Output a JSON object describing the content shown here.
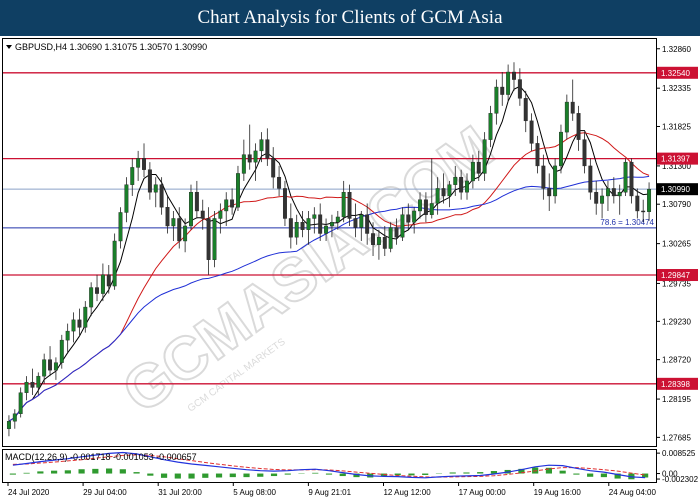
{
  "banner": {
    "title": "Chart Analysis for Clients of GCM Asia"
  },
  "header": {
    "symbol_line": "GBPUSD,H4  1.30690 1.31075 1.30570 1.30990",
    "macd_line": "MACD(12,26,9) -0.001718 -0.001053 -0.000657"
  },
  "watermark": {
    "text": "GCMASIA.COM",
    "subtext": "GCM CAPITAL MARKETS"
  },
  "colors": {
    "bull": "#1a7f2a",
    "bear": "#333333",
    "ma_fast": "#000000",
    "ma_mid": "#d01818",
    "ma_slow": "#1f2fd6",
    "resistance": "#cc1133",
    "fib": "#2233aa",
    "last_price_line": "#8aa0c8",
    "macd_signal": "#e03030",
    "macd_main": "#2233dd",
    "histogram": "#2f9a2f"
  },
  "chart_data": [
    {
      "type": "candlestick",
      "title": "GBPUSD,H4",
      "ylim": [
        1.2765,
        1.3295
      ],
      "y_ticks": [
        "1.32860",
        "1.32335",
        "1.31825",
        "1.31300",
        "1.30790",
        "1.30265",
        "1.29735",
        "1.29230",
        "1.28720",
        "1.28195",
        "1.27685"
      ],
      "x_ticks": [
        "24 Jul 2020",
        "29 Jul 04:00",
        "31 Jul 20:00",
        "5 Aug 08:00",
        "9 Aug 21:01",
        "12 Aug 12:00",
        "17 Aug 00:00",
        "19 Aug 16:00",
        "24 Aug 04:00"
      ],
      "grid": false,
      "candles": [
        {
          "o": 1.278,
          "h": 1.2798,
          "l": 1.277,
          "c": 1.279
        },
        {
          "o": 1.279,
          "h": 1.2806,
          "l": 1.278,
          "c": 1.28
        },
        {
          "o": 1.28,
          "h": 1.2835,
          "l": 1.2795,
          "c": 1.2828
        },
        {
          "o": 1.2828,
          "h": 1.285,
          "l": 1.2818,
          "c": 1.2842
        },
        {
          "o": 1.2842,
          "h": 1.286,
          "l": 1.2825,
          "c": 1.2835
        },
        {
          "o": 1.2835,
          "h": 1.2855,
          "l": 1.2825,
          "c": 1.285
        },
        {
          "o": 1.285,
          "h": 1.288,
          "l": 1.284,
          "c": 1.2872
        },
        {
          "o": 1.2872,
          "h": 1.289,
          "l": 1.285,
          "c": 1.2858
        },
        {
          "o": 1.2858,
          "h": 1.2875,
          "l": 1.2845,
          "c": 1.2868
        },
        {
          "o": 1.2868,
          "h": 1.2905,
          "l": 1.286,
          "c": 1.2898
        },
        {
          "o": 1.2898,
          "h": 1.292,
          "l": 1.288,
          "c": 1.291
        },
        {
          "o": 1.291,
          "h": 1.2935,
          "l": 1.2895,
          "c": 1.2925
        },
        {
          "o": 1.2925,
          "h": 1.294,
          "l": 1.2905,
          "c": 1.2915
        },
        {
          "o": 1.2915,
          "h": 1.295,
          "l": 1.2908,
          "c": 1.2942
        },
        {
          "o": 1.2942,
          "h": 1.2975,
          "l": 1.293,
          "c": 1.2968
        },
        {
          "o": 1.2968,
          "h": 1.2985,
          "l": 1.295,
          "c": 1.296
        },
        {
          "o": 1.296,
          "h": 1.3,
          "l": 1.295,
          "c": 1.2985
        },
        {
          "o": 1.2985,
          "h": 1.2998,
          "l": 1.296,
          "c": 1.297
        },
        {
          "o": 1.297,
          "h": 1.304,
          "l": 1.2965,
          "c": 1.303
        },
        {
          "o": 1.303,
          "h": 1.3075,
          "l": 1.302,
          "c": 1.3068
        },
        {
          "o": 1.3068,
          "h": 1.3115,
          "l": 1.3055,
          "c": 1.3105
        },
        {
          "o": 1.3105,
          "h": 1.314,
          "l": 1.309,
          "c": 1.3128
        },
        {
          "o": 1.3128,
          "h": 1.315,
          "l": 1.311,
          "c": 1.314
        },
        {
          "o": 1.314,
          "h": 1.316,
          "l": 1.3115,
          "c": 1.3125
        },
        {
          "o": 1.3125,
          "h": 1.3135,
          "l": 1.3085,
          "c": 1.3095
        },
        {
          "o": 1.3095,
          "h": 1.3115,
          "l": 1.3075,
          "c": 1.3105
        },
        {
          "o": 1.3105,
          "h": 1.3115,
          "l": 1.3065,
          "c": 1.3075
        },
        {
          "o": 1.3075,
          "h": 1.309,
          "l": 1.304,
          "c": 1.305
        },
        {
          "o": 1.305,
          "h": 1.307,
          "l": 1.303,
          "c": 1.306
        },
        {
          "o": 1.306,
          "h": 1.3075,
          "l": 1.302,
          "c": 1.303
        },
        {
          "o": 1.303,
          "h": 1.306,
          "l": 1.3015,
          "c": 1.305
        },
        {
          "o": 1.305,
          "h": 1.3105,
          "l": 1.3045,
          "c": 1.3095
        },
        {
          "o": 1.3095,
          "h": 1.311,
          "l": 1.306,
          "c": 1.307
        },
        {
          "o": 1.307,
          "h": 1.3085,
          "l": 1.3045,
          "c": 1.306
        },
        {
          "o": 1.306,
          "h": 1.3075,
          "l": 1.2985,
          "c": 1.3005
        },
        {
          "o": 1.3005,
          "h": 1.307,
          "l": 1.2995,
          "c": 1.306
        },
        {
          "o": 1.306,
          "h": 1.308,
          "l": 1.304,
          "c": 1.307
        },
        {
          "o": 1.307,
          "h": 1.3095,
          "l": 1.305,
          "c": 1.3085
        },
        {
          "o": 1.3085,
          "h": 1.31,
          "l": 1.3065,
          "c": 1.3075
        },
        {
          "o": 1.3075,
          "h": 1.313,
          "l": 1.307,
          "c": 1.312
        },
        {
          "o": 1.312,
          "h": 1.3165,
          "l": 1.311,
          "c": 1.3145
        },
        {
          "o": 1.3145,
          "h": 1.3185,
          "l": 1.3125,
          "c": 1.3135
        },
        {
          "o": 1.3135,
          "h": 1.316,
          "l": 1.311,
          "c": 1.315
        },
        {
          "o": 1.315,
          "h": 1.3175,
          "l": 1.3135,
          "c": 1.3165
        },
        {
          "o": 1.3165,
          "h": 1.318,
          "l": 1.313,
          "c": 1.314
        },
        {
          "o": 1.314,
          "h": 1.3155,
          "l": 1.31,
          "c": 1.3115
        },
        {
          "o": 1.3115,
          "h": 1.313,
          "l": 1.309,
          "c": 1.31
        },
        {
          "o": 1.31,
          "h": 1.311,
          "l": 1.305,
          "c": 1.306
        },
        {
          "o": 1.306,
          "h": 1.308,
          "l": 1.302,
          "c": 1.3035
        },
        {
          "o": 1.3035,
          "h": 1.3065,
          "l": 1.3025,
          "c": 1.3055
        },
        {
          "o": 1.3055,
          "h": 1.307,
          "l": 1.3035,
          "c": 1.3045
        },
        {
          "o": 1.3045,
          "h": 1.307,
          "l": 1.3025,
          "c": 1.306
        },
        {
          "o": 1.306,
          "h": 1.3075,
          "l": 1.304,
          "c": 1.3065
        },
        {
          "o": 1.3065,
          "h": 1.308,
          "l": 1.303,
          "c": 1.304
        },
        {
          "o": 1.304,
          "h": 1.306,
          "l": 1.303,
          "c": 1.305
        },
        {
          "o": 1.305,
          "h": 1.3065,
          "l": 1.3035,
          "c": 1.3055
        },
        {
          "o": 1.3055,
          "h": 1.307,
          "l": 1.3045,
          "c": 1.3062
        },
        {
          "o": 1.3062,
          "h": 1.311,
          "l": 1.3055,
          "c": 1.3095
        },
        {
          "o": 1.3095,
          "h": 1.3105,
          "l": 1.305,
          "c": 1.306
        },
        {
          "o": 1.306,
          "h": 1.308,
          "l": 1.3035,
          "c": 1.3048
        },
        {
          "o": 1.3048,
          "h": 1.307,
          "l": 1.303,
          "c": 1.3065
        },
        {
          "o": 1.3065,
          "h": 1.308,
          "l": 1.3025,
          "c": 1.304
        },
        {
          "o": 1.304,
          "h": 1.3055,
          "l": 1.301,
          "c": 1.3025
        },
        {
          "o": 1.3025,
          "h": 1.3045,
          "l": 1.3005,
          "c": 1.3035
        },
        {
          "o": 1.3035,
          "h": 1.305,
          "l": 1.301,
          "c": 1.302
        },
        {
          "o": 1.302,
          "h": 1.3055,
          "l": 1.3015,
          "c": 1.3048
        },
        {
          "o": 1.3048,
          "h": 1.306,
          "l": 1.3025,
          "c": 1.3035
        },
        {
          "o": 1.3035,
          "h": 1.3075,
          "l": 1.303,
          "c": 1.3065
        },
        {
          "o": 1.3065,
          "h": 1.308,
          "l": 1.3045,
          "c": 1.3055
        },
        {
          "o": 1.3055,
          "h": 1.3075,
          "l": 1.304,
          "c": 1.307
        },
        {
          "o": 1.307,
          "h": 1.3095,
          "l": 1.306,
          "c": 1.3085
        },
        {
          "o": 1.3085,
          "h": 1.3095,
          "l": 1.3055,
          "c": 1.3065
        },
        {
          "o": 1.3065,
          "h": 1.314,
          "l": 1.306,
          "c": 1.308
        },
        {
          "o": 1.308,
          "h": 1.3115,
          "l": 1.3065,
          "c": 1.31
        },
        {
          "o": 1.31,
          "h": 1.312,
          "l": 1.308,
          "c": 1.309
        },
        {
          "o": 1.309,
          "h": 1.311,
          "l": 1.3075,
          "c": 1.3105
        },
        {
          "o": 1.3105,
          "h": 1.313,
          "l": 1.309,
          "c": 1.3115
        },
        {
          "o": 1.3115,
          "h": 1.3125,
          "l": 1.3085,
          "c": 1.3095
        },
        {
          "o": 1.3095,
          "h": 1.312,
          "l": 1.3085,
          "c": 1.311
        },
        {
          "o": 1.311,
          "h": 1.3145,
          "l": 1.31,
          "c": 1.3135
        },
        {
          "o": 1.3135,
          "h": 1.315,
          "l": 1.311,
          "c": 1.312
        },
        {
          "o": 1.312,
          "h": 1.3175,
          "l": 1.311,
          "c": 1.3165
        },
        {
          "o": 1.3165,
          "h": 1.321,
          "l": 1.3155,
          "c": 1.32
        },
        {
          "o": 1.32,
          "h": 1.3245,
          "l": 1.3185,
          "c": 1.3235
        },
        {
          "o": 1.3235,
          "h": 1.3255,
          "l": 1.321,
          "c": 1.3225
        },
        {
          "o": 1.3225,
          "h": 1.3265,
          "l": 1.3215,
          "c": 1.3255
        },
        {
          "o": 1.3255,
          "h": 1.3268,
          "l": 1.323,
          "c": 1.3245
        },
        {
          "o": 1.3245,
          "h": 1.326,
          "l": 1.321,
          "c": 1.322
        },
        {
          "o": 1.322,
          "h": 1.323,
          "l": 1.3175,
          "c": 1.319
        },
        {
          "o": 1.319,
          "h": 1.32,
          "l": 1.315,
          "c": 1.316
        },
        {
          "o": 1.316,
          "h": 1.317,
          "l": 1.312,
          "c": 1.313
        },
        {
          "o": 1.313,
          "h": 1.3145,
          "l": 1.3085,
          "c": 1.31
        },
        {
          "o": 1.31,
          "h": 1.312,
          "l": 1.307,
          "c": 1.309
        },
        {
          "o": 1.309,
          "h": 1.314,
          "l": 1.308,
          "c": 1.313
        },
        {
          "o": 1.313,
          "h": 1.3185,
          "l": 1.312,
          "c": 1.3175
        },
        {
          "o": 1.3175,
          "h": 1.3225,
          "l": 1.3165,
          "c": 1.3215
        },
        {
          "o": 1.3215,
          "h": 1.3245,
          "l": 1.319,
          "c": 1.32
        },
        {
          "o": 1.32,
          "h": 1.321,
          "l": 1.315,
          "c": 1.3165
        },
        {
          "o": 1.3165,
          "h": 1.3175,
          "l": 1.312,
          "c": 1.313
        },
        {
          "o": 1.313,
          "h": 1.314,
          "l": 1.3085,
          "c": 1.3095
        },
        {
          "o": 1.3095,
          "h": 1.311,
          "l": 1.3065,
          "c": 1.308
        },
        {
          "o": 1.308,
          "h": 1.31,
          "l": 1.306,
          "c": 1.309
        },
        {
          "o": 1.309,
          "h": 1.311,
          "l": 1.307,
          "c": 1.31
        },
        {
          "o": 1.31,
          "h": 1.3115,
          "l": 1.308,
          "c": 1.309
        },
        {
          "o": 1.309,
          "h": 1.3105,
          "l": 1.3065,
          "c": 1.3095
        },
        {
          "o": 1.3095,
          "h": 1.314,
          "l": 1.309,
          "c": 1.3135
        },
        {
          "o": 1.3135,
          "h": 1.314,
          "l": 1.308,
          "c": 1.309
        },
        {
          "o": 1.309,
          "h": 1.31,
          "l": 1.306,
          "c": 1.307
        },
        {
          "o": 1.307,
          "h": 1.3085,
          "l": 1.3055,
          "c": 1.3069
        },
        {
          "o": 1.3069,
          "h": 1.3108,
          "l": 1.3057,
          "c": 1.3099
        }
      ],
      "horizontal_lines": [
        {
          "kind": "resistance",
          "value": 1.3254,
          "label": "1.32540"
        },
        {
          "kind": "resistance",
          "value": 1.31397,
          "label": "1.31397"
        },
        {
          "kind": "current_price",
          "value": 1.3099,
          "label": "1.30990"
        },
        {
          "kind": "fibonacci",
          "value": 1.30474,
          "label": "78.6  = 1.30474"
        },
        {
          "kind": "support",
          "value": 1.29847,
          "label": "1.29847"
        },
        {
          "kind": "support",
          "value": 1.28398,
          "label": "1.28398"
        }
      ]
    },
    {
      "type": "line",
      "title": "MACD(12,26,9)",
      "ylim": [
        -0.0027,
        0.009
      ],
      "y_ticks": [
        "0.008525",
        "0.00",
        "-0.002302"
      ],
      "series": [
        {
          "name": "MACD",
          "style": "solid",
          "values": [
            0.0035,
            0.0042,
            0.005,
            0.0056,
            0.0062,
            0.007,
            0.0077,
            0.0084,
            0.0088,
            0.0082,
            0.007,
            0.0058,
            0.0048,
            0.004,
            0.0034,
            0.0028,
            0.0022,
            0.0016,
            0.0012,
            0.001,
            0.0012,
            0.0016,
            0.0018,
            0.0012,
            0.0004,
            -0.0004,
            -0.001,
            -0.0012,
            -0.0013,
            -0.0016,
            -0.0018,
            -0.0014,
            -0.0011,
            -0.001,
            -0.0008,
            -0.0002,
            0.0006,
            0.0016,
            0.0028,
            0.0035,
            0.0033,
            0.0022,
            0.0012,
            0.0006,
            -0.0004,
            -0.0014,
            -0.0017
          ]
        },
        {
          "name": "Signal",
          "style": "dashed",
          "values": [
            0.0038,
            0.004,
            0.0044,
            0.0048,
            0.0053,
            0.0058,
            0.0064,
            0.007,
            0.0076,
            0.0078,
            0.0076,
            0.007,
            0.0062,
            0.0054,
            0.0046,
            0.0039,
            0.0032,
            0.0026,
            0.0021,
            0.0017,
            0.0015,
            0.0015,
            0.0016,
            0.0015,
            0.0011,
            0.0006,
            0.0001,
            -0.0004,
            -0.0008,
            -0.0011,
            -0.0014,
            -0.0015,
            -0.0014,
            -0.0013,
            -0.0012,
            -0.0009,
            -0.0004,
            0.0003,
            0.0011,
            0.0019,
            0.0025,
            0.0025,
            0.0021,
            0.0016,
            0.001,
            0.0002,
            -0.0006
          ]
        }
      ]
    }
  ]
}
